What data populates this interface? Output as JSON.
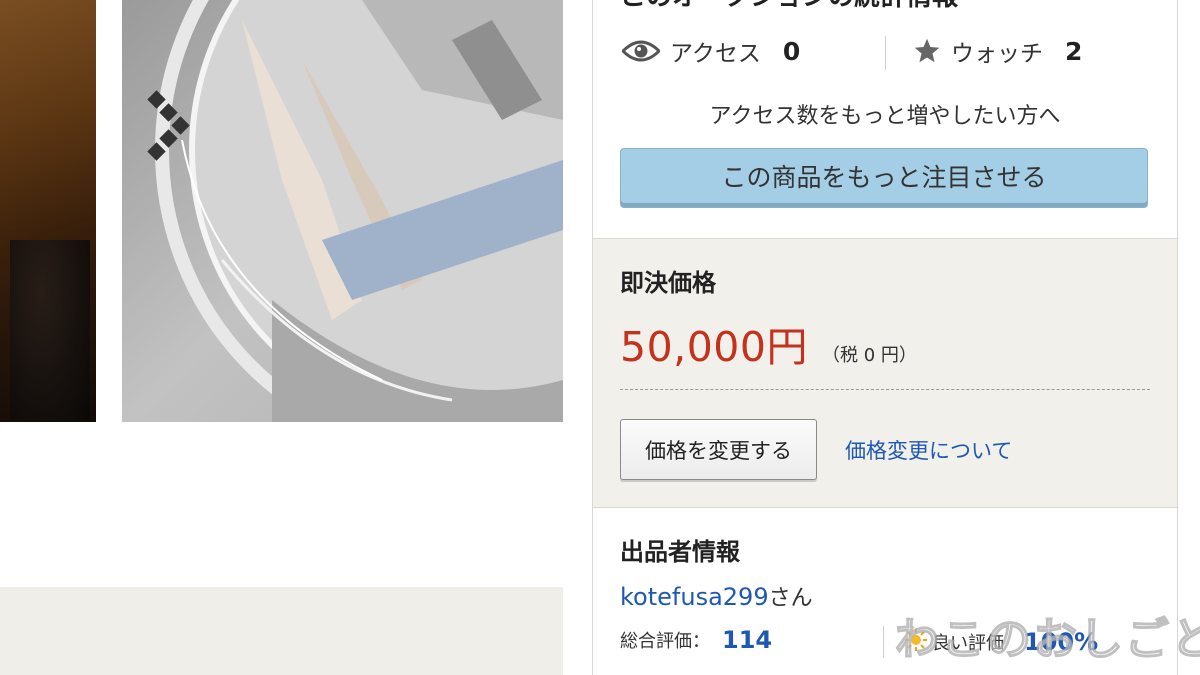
{
  "stats": {
    "title": "このオークションの統計情報",
    "access_label": "アクセス",
    "access_count": "0",
    "watch_label": "ウォッチ",
    "watch_count": "2",
    "promo_text": "アクセス数をもっと増やしたい方へ",
    "promo_button": "この商品をもっと注目させる"
  },
  "price": {
    "label": "即決価格",
    "value": "50,000円",
    "tax": "（税 0 円）",
    "change_button": "価格を変更する",
    "change_link": "価格変更について"
  },
  "seller": {
    "title": "出品者情報",
    "name": "kotefusa299",
    "name_suffix": "さん",
    "total_label": "総合評価：",
    "total_value": "114",
    "good_label": "良い評価",
    "good_value": "100%"
  },
  "watermark": "わこのおしごと",
  "colors": {
    "price_red": "#c4311c",
    "link_blue": "#1e58b5",
    "promo_button_bg": "#a4cde6",
    "panel_bg": "#f1f0eb"
  },
  "icons": {
    "access": "eye-icon",
    "watch": "star-icon",
    "next": "chevron-right-icon",
    "good_rating": "sun-icon"
  }
}
